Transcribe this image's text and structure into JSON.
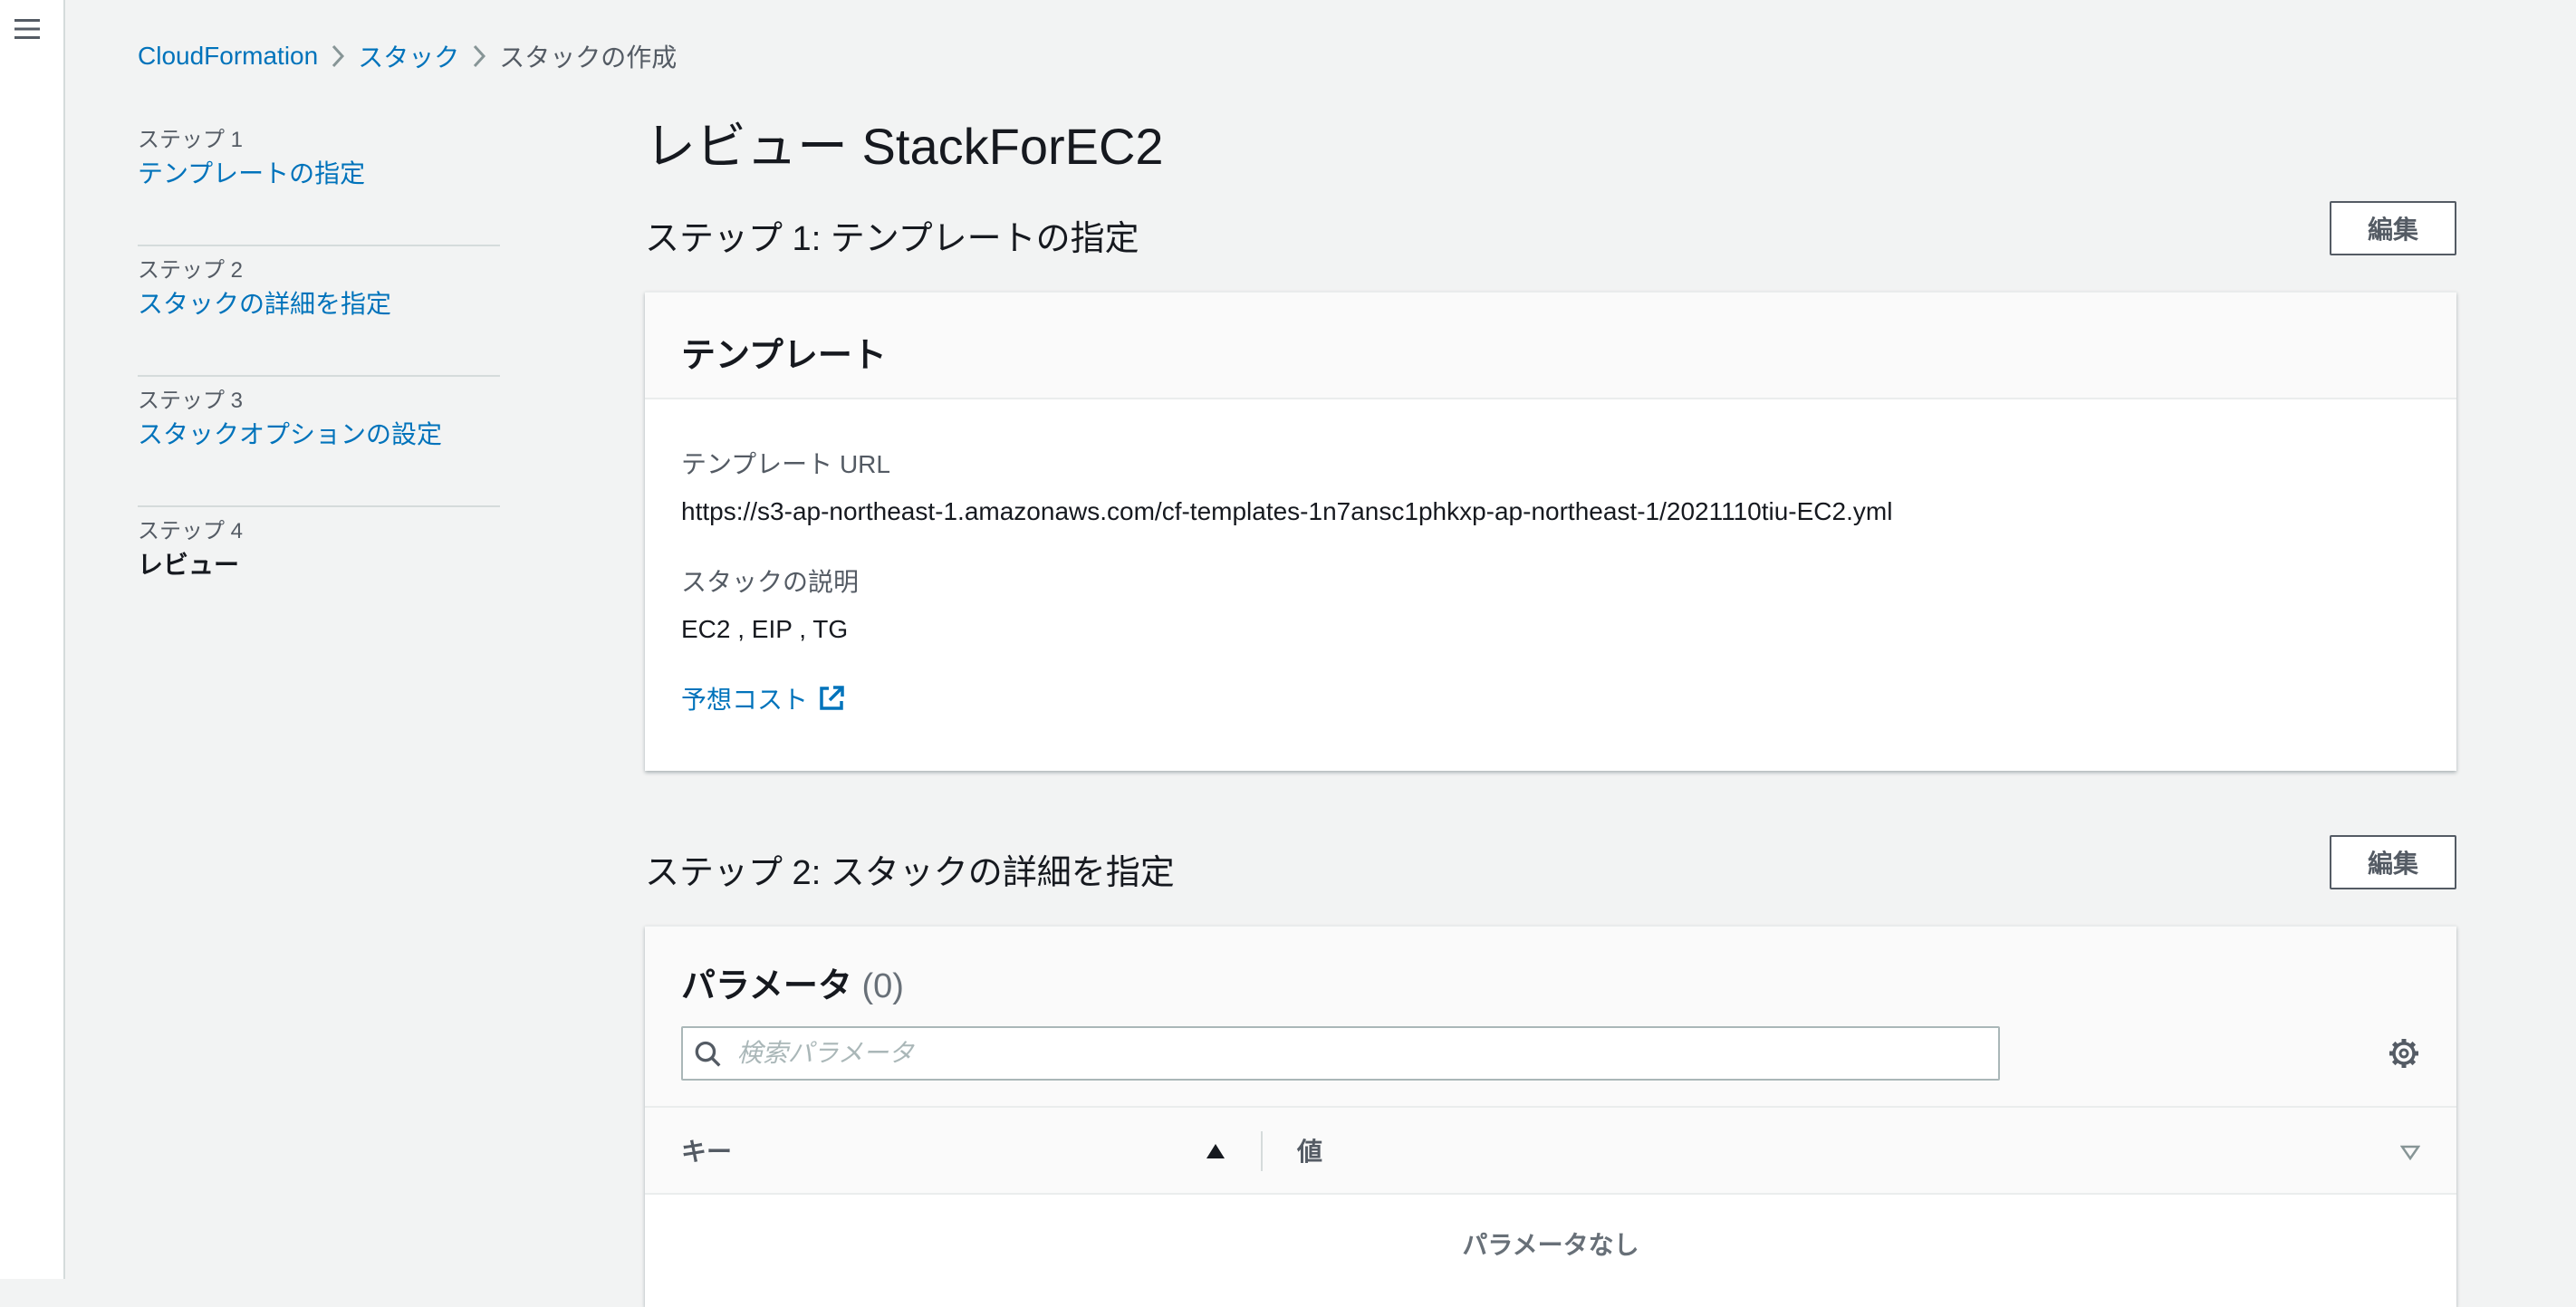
{
  "breadcrumb": {
    "items": [
      {
        "label": "CloudFormation"
      },
      {
        "label": "スタック"
      },
      {
        "label": "スタックの作成"
      }
    ]
  },
  "wizard": {
    "steps": [
      {
        "number": "ステップ 1",
        "label": "テンプレートの指定"
      },
      {
        "number": "ステップ 2",
        "label": "スタックの詳細を指定"
      },
      {
        "number": "ステップ 3",
        "label": "スタックオプションの設定"
      },
      {
        "number": "ステップ 4",
        "label": "レビュー"
      }
    ]
  },
  "page": {
    "title": "レビュー StackForEC2"
  },
  "step1": {
    "title": "ステップ 1: テンプレートの指定",
    "edit_label": "編集",
    "card_title": "テンプレート",
    "template_url_label": "テンプレート URL",
    "template_url": "https://s3-ap-northeast-1.amazonaws.com/cf-templates-1n7ansc1phkxp-ap-northeast-1/2021110tiu-EC2.yml",
    "description_label": "スタックの説明",
    "description": "EC2 , EIP , TG",
    "cost_link": "予想コスト"
  },
  "step2": {
    "title": "ステップ 2: スタックの詳細を指定",
    "edit_label": "編集",
    "card_title": "パラメータ",
    "count": "(0)",
    "search_placeholder": "検索パラメータ",
    "columns": {
      "key": "キー",
      "value": "値"
    },
    "empty_message": "パラメータなし"
  },
  "colors": {
    "link": "#0073bb",
    "background": "#f2f3f3"
  }
}
